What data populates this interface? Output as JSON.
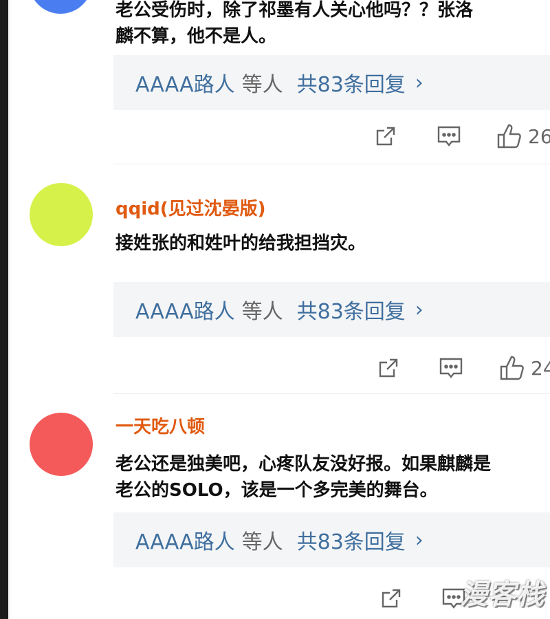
{
  "comments": [
    {
      "avatar_color": "#4a7ef0",
      "username": "",
      "text_lines": [
        "老公受伤时，除了祁墨有人关心他吗？？张洛",
        "麟不算，他不是人。"
      ],
      "reply": {
        "users": "AAAA路人",
        "etc": "等人",
        "count": "共83条回复",
        "chevron": "›"
      },
      "likes": "26"
    },
    {
      "avatar_color": "#d6f24a",
      "username": "qqid(见过沈晏版)",
      "text_lines": [
        "接姓张的和姓叶的给我担挡灾。"
      ],
      "reply": {
        "users": "AAAA路人",
        "etc": "等人",
        "count": "共83条回复",
        "chevron": "›"
      },
      "likes": "24"
    },
    {
      "avatar_color": "#f55a5a",
      "username": "一天吃八顿",
      "text_lines": [
        "老公还是独美吧，心疼队友没好报。如果麒麟是",
        "老公的SOLO，该是一个多完美的舞台。"
      ],
      "reply": {
        "users": "AAAA路人",
        "etc": "等人",
        "count": "共83条回复",
        "chevron": "›"
      },
      "likes": ""
    }
  ],
  "icons": {
    "share": "share-icon",
    "comment": "comment-icon",
    "like": "thumbs-up-icon"
  },
  "watermark": "漫客栈"
}
